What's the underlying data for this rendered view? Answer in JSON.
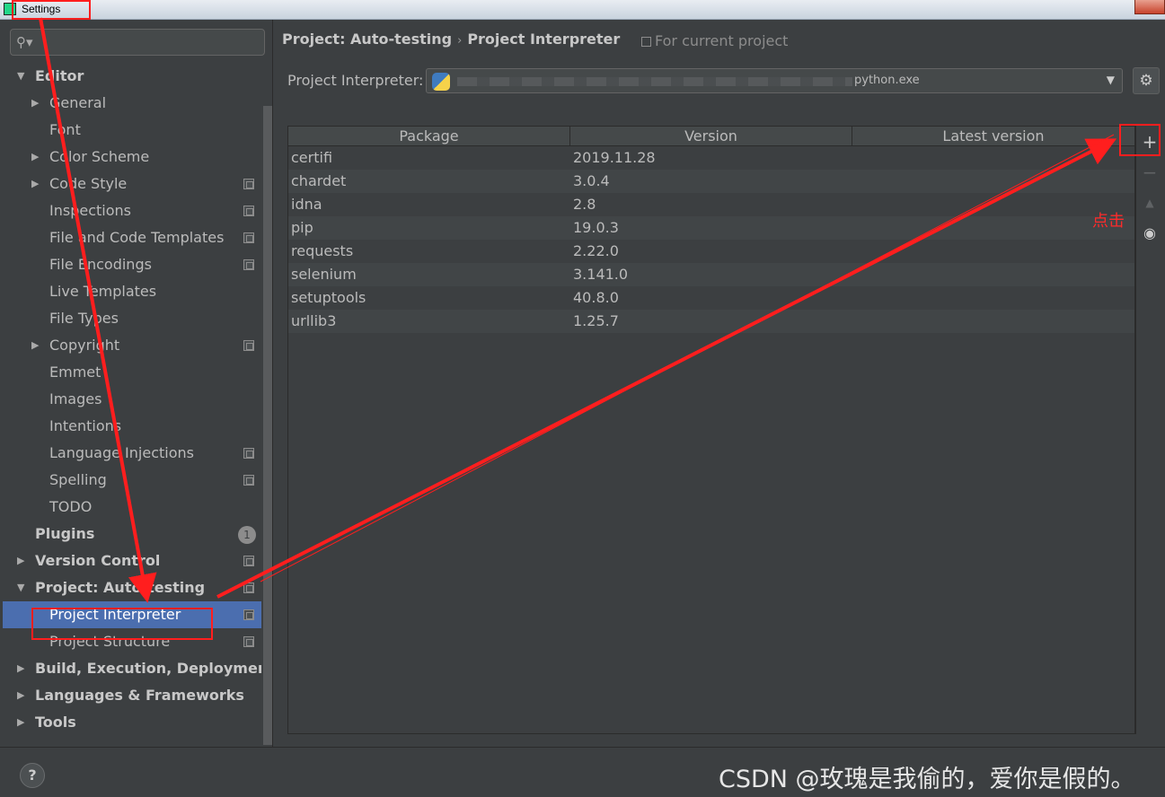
{
  "window": {
    "title": "Settings"
  },
  "sidebar": {
    "search_placeholder": "",
    "items": [
      {
        "label": "Editor",
        "bold": true,
        "arrow": "down",
        "indent": 0
      },
      {
        "label": "General",
        "arrow": "right",
        "indent": 1
      },
      {
        "label": "Font",
        "indent": 1
      },
      {
        "label": "Color Scheme",
        "arrow": "right",
        "indent": 1
      },
      {
        "label": "Code Style",
        "arrow": "right",
        "indent": 1,
        "scope": true
      },
      {
        "label": "Inspections",
        "indent": 1,
        "scope": true
      },
      {
        "label": "File and Code Templates",
        "indent": 1,
        "scope": true
      },
      {
        "label": "File Encodings",
        "indent": 1,
        "scope": true
      },
      {
        "label": "Live Templates",
        "indent": 1
      },
      {
        "label": "File Types",
        "indent": 1
      },
      {
        "label": "Copyright",
        "arrow": "right",
        "indent": 1,
        "scope": true
      },
      {
        "label": "Emmet",
        "indent": 1
      },
      {
        "label": "Images",
        "indent": 1
      },
      {
        "label": "Intentions",
        "indent": 1
      },
      {
        "label": "Language Injections",
        "indent": 1,
        "scope": true
      },
      {
        "label": "Spelling",
        "indent": 1,
        "scope": true
      },
      {
        "label": "TODO",
        "indent": 1
      },
      {
        "label": "Plugins",
        "bold": true,
        "indent": 0,
        "badge": "1"
      },
      {
        "label": "Version Control",
        "bold": true,
        "arrow": "right",
        "indent": 0,
        "scope": true
      },
      {
        "label": "Project: Auto-testing",
        "bold": true,
        "arrow": "down",
        "indent": 0,
        "scope": true
      },
      {
        "label": "Project Interpreter",
        "indent": 1,
        "scope": true,
        "selected": true
      },
      {
        "label": "Project Structure",
        "indent": 1,
        "scope": true
      },
      {
        "label": "Build, Execution, Deployment",
        "bold": true,
        "arrow": "right",
        "indent": 0
      },
      {
        "label": "Languages & Frameworks",
        "bold": true,
        "arrow": "right",
        "indent": 0
      },
      {
        "label": "Tools",
        "bold": true,
        "arrow": "right",
        "indent": 0
      }
    ]
  },
  "breadcrumb": {
    "project": "Project: Auto-testing",
    "separator": "›",
    "page": "Project Interpreter"
  },
  "for_current_project": "For current project",
  "interpreter": {
    "label": "Project Interpreter:",
    "value_suffix": "python.exe"
  },
  "table": {
    "headers": [
      "Package",
      "Version",
      "Latest version"
    ],
    "rows": [
      {
        "package": "certifi",
        "version": "2019.11.28",
        "latest": ""
      },
      {
        "package": "chardet",
        "version": "3.0.4",
        "latest": ""
      },
      {
        "package": "idna",
        "version": "2.8",
        "latest": ""
      },
      {
        "package": "pip",
        "version": "19.0.3",
        "latest": ""
      },
      {
        "package": "requests",
        "version": "2.22.0",
        "latest": ""
      },
      {
        "package": "selenium",
        "version": "3.141.0",
        "latest": ""
      },
      {
        "package": "setuptools",
        "version": "40.8.0",
        "latest": ""
      },
      {
        "package": "urllib3",
        "version": "1.25.7",
        "latest": ""
      }
    ]
  },
  "tools": {
    "add": "+",
    "remove": "−",
    "upgrade": "▲",
    "show": "👁"
  },
  "help_label": "?",
  "annotation_click": "点击",
  "watermark": "CSDN @玫瑰是我偷的，爱你是假的。",
  "colors": {
    "background": "#3c3f41",
    "selection": "#4b6eaf",
    "annotation": "#ff1e1e"
  }
}
